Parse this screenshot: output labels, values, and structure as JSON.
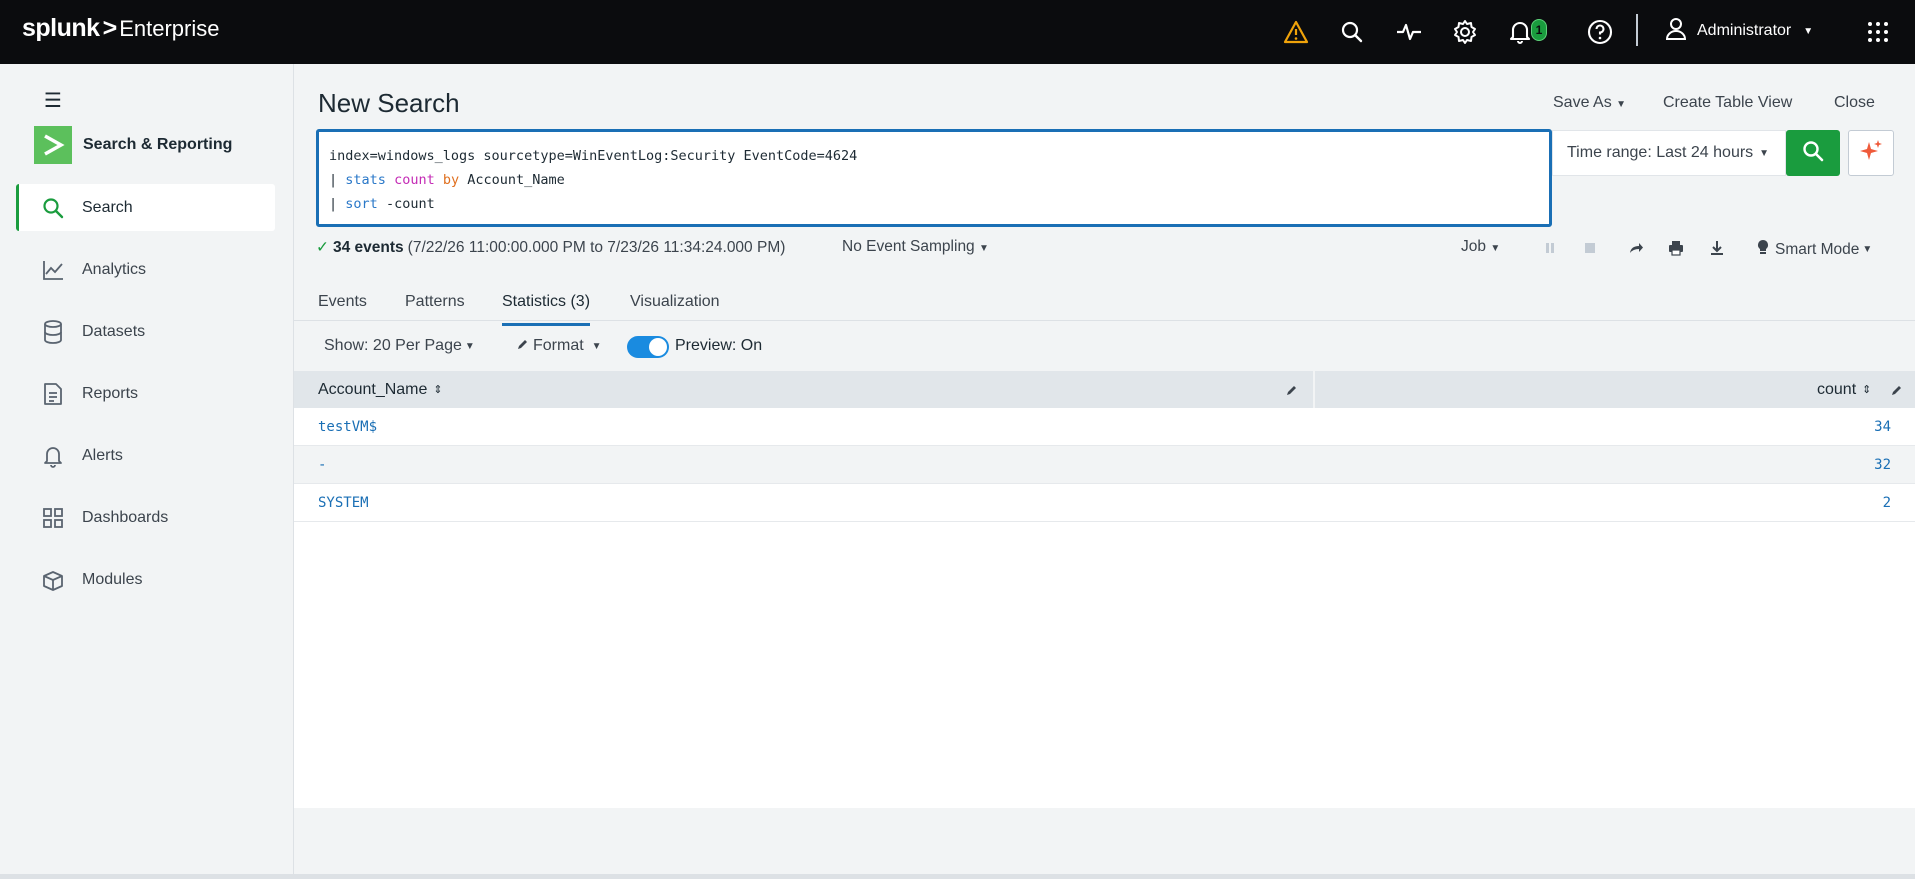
{
  "header": {
    "brand": "splunk",
    "product": "Enterprise",
    "notification_count": "1",
    "user": "Administrator"
  },
  "sidebar": {
    "app_name": "Search & Reporting",
    "items": [
      {
        "label": "Search",
        "icon": "search-icon",
        "active": true
      },
      {
        "label": "Analytics",
        "icon": "line-chart-icon"
      },
      {
        "label": "Datasets",
        "icon": "database-icon"
      },
      {
        "label": "Reports",
        "icon": "document-icon"
      },
      {
        "label": "Alerts",
        "icon": "bell-icon"
      },
      {
        "label": "Dashboards",
        "icon": "dashboard-icon"
      },
      {
        "label": "Modules",
        "icon": "box-icon"
      }
    ]
  },
  "main": {
    "title": "New Search",
    "save_as": "Save As",
    "create_table_view": "Create Table View",
    "close": "Close",
    "query": {
      "line1": "index=windows_logs sourcetype=WinEventLog:Security EventCode=4624",
      "line2_cmd": "stats",
      "line2_fn": "count",
      "line2_by": "by",
      "line2_field": "Account_Name",
      "line3_cmd": "sort",
      "line3_arg": "-count"
    },
    "time_range": "Time range: Last 24 hours",
    "status": {
      "events": "34 events",
      "range": "(7/22/26 11:00:00.000 PM to 7/23/26 11:34:24.000 PM)"
    },
    "sampling": "No Event Sampling",
    "job": "Job",
    "mode": "Smart Mode",
    "tabs": [
      "Events",
      "Patterns",
      "Statistics (3)",
      "Visualization"
    ],
    "toolbar": {
      "show": "Show: 20 Per Page",
      "format": "Format",
      "preview": "Preview: On"
    },
    "table": {
      "columns": [
        "Account_Name",
        "count"
      ],
      "rows": [
        [
          "testVM$",
          "34"
        ],
        [
          "-",
          "32"
        ],
        [
          "SYSTEM",
          "2"
        ]
      ]
    }
  },
  "colors": {
    "accent_green": "#1a9c3e",
    "accent_blue": "#1a6fb5",
    "warning": "#f0a30a"
  }
}
